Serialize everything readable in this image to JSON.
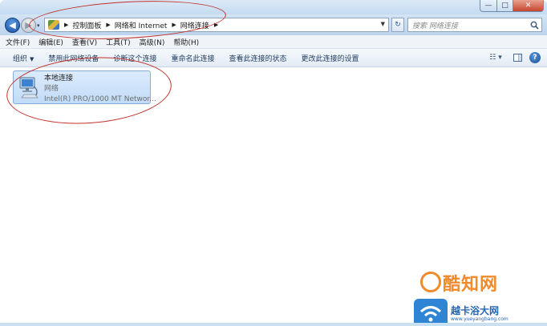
{
  "window": {
    "caption": {
      "minimize": "—",
      "maximize": "□",
      "close": "✕"
    }
  },
  "nav": {
    "back": "◀",
    "forward": "▶",
    "recent": "▾"
  },
  "address": {
    "icon": "control-panel-icon",
    "breadcrumbs": [
      "控制面板",
      "网络和 Internet",
      "网络连接"
    ],
    "separator": "▶",
    "dropdown": "▼",
    "refresh": "↻"
  },
  "search": {
    "placeholder": "搜索 网络连接",
    "icon": "search-icon"
  },
  "menubar": {
    "items": [
      "文件(F)",
      "编辑(E)",
      "查看(V)",
      "工具(T)",
      "高级(N)",
      "帮助(H)"
    ]
  },
  "commandbar": {
    "items": [
      "组织",
      "禁用此网络设备",
      "诊断这个连接",
      "重命名此连接",
      "查看此连接的状态",
      "更改此连接的设置"
    ],
    "organize_arrow": "▼",
    "view_glyph": "☷ ▾",
    "help": "?"
  },
  "connection": {
    "name": "本地连接",
    "network": "网络",
    "device": "Intel(R) PRO/1000 MT Networ..."
  },
  "watermark": {
    "brand": "酷知网",
    "site": "越卡浴大网",
    "url": "www.yueyangbang.com"
  },
  "colors": {
    "accent": "#2a5f9e",
    "annotation": "#c2312a",
    "watermark_orange": "#f08a2a",
    "watermark_blue": "#2466b5"
  }
}
